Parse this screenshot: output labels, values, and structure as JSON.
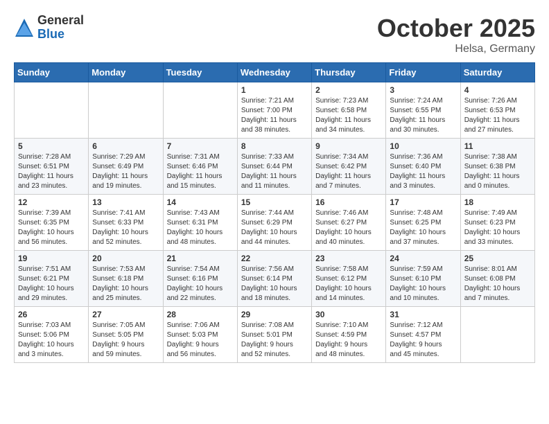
{
  "header": {
    "logo_general": "General",
    "logo_blue": "Blue",
    "month": "October 2025",
    "location": "Helsa, Germany"
  },
  "days_of_week": [
    "Sunday",
    "Monday",
    "Tuesday",
    "Wednesday",
    "Thursday",
    "Friday",
    "Saturday"
  ],
  "weeks": [
    [
      {
        "day": "",
        "info": ""
      },
      {
        "day": "",
        "info": ""
      },
      {
        "day": "",
        "info": ""
      },
      {
        "day": "1",
        "info": "Sunrise: 7:21 AM\nSunset: 7:00 PM\nDaylight: 11 hours\nand 38 minutes."
      },
      {
        "day": "2",
        "info": "Sunrise: 7:23 AM\nSunset: 6:58 PM\nDaylight: 11 hours\nand 34 minutes."
      },
      {
        "day": "3",
        "info": "Sunrise: 7:24 AM\nSunset: 6:55 PM\nDaylight: 11 hours\nand 30 minutes."
      },
      {
        "day": "4",
        "info": "Sunrise: 7:26 AM\nSunset: 6:53 PM\nDaylight: 11 hours\nand 27 minutes."
      }
    ],
    [
      {
        "day": "5",
        "info": "Sunrise: 7:28 AM\nSunset: 6:51 PM\nDaylight: 11 hours\nand 23 minutes."
      },
      {
        "day": "6",
        "info": "Sunrise: 7:29 AM\nSunset: 6:49 PM\nDaylight: 11 hours\nand 19 minutes."
      },
      {
        "day": "7",
        "info": "Sunrise: 7:31 AM\nSunset: 6:46 PM\nDaylight: 11 hours\nand 15 minutes."
      },
      {
        "day": "8",
        "info": "Sunrise: 7:33 AM\nSunset: 6:44 PM\nDaylight: 11 hours\nand 11 minutes."
      },
      {
        "day": "9",
        "info": "Sunrise: 7:34 AM\nSunset: 6:42 PM\nDaylight: 11 hours\nand 7 minutes."
      },
      {
        "day": "10",
        "info": "Sunrise: 7:36 AM\nSunset: 6:40 PM\nDaylight: 11 hours\nand 3 minutes."
      },
      {
        "day": "11",
        "info": "Sunrise: 7:38 AM\nSunset: 6:38 PM\nDaylight: 11 hours\nand 0 minutes."
      }
    ],
    [
      {
        "day": "12",
        "info": "Sunrise: 7:39 AM\nSunset: 6:35 PM\nDaylight: 10 hours\nand 56 minutes."
      },
      {
        "day": "13",
        "info": "Sunrise: 7:41 AM\nSunset: 6:33 PM\nDaylight: 10 hours\nand 52 minutes."
      },
      {
        "day": "14",
        "info": "Sunrise: 7:43 AM\nSunset: 6:31 PM\nDaylight: 10 hours\nand 48 minutes."
      },
      {
        "day": "15",
        "info": "Sunrise: 7:44 AM\nSunset: 6:29 PM\nDaylight: 10 hours\nand 44 minutes."
      },
      {
        "day": "16",
        "info": "Sunrise: 7:46 AM\nSunset: 6:27 PM\nDaylight: 10 hours\nand 40 minutes."
      },
      {
        "day": "17",
        "info": "Sunrise: 7:48 AM\nSunset: 6:25 PM\nDaylight: 10 hours\nand 37 minutes."
      },
      {
        "day": "18",
        "info": "Sunrise: 7:49 AM\nSunset: 6:23 PM\nDaylight: 10 hours\nand 33 minutes."
      }
    ],
    [
      {
        "day": "19",
        "info": "Sunrise: 7:51 AM\nSunset: 6:21 PM\nDaylight: 10 hours\nand 29 minutes."
      },
      {
        "day": "20",
        "info": "Sunrise: 7:53 AM\nSunset: 6:18 PM\nDaylight: 10 hours\nand 25 minutes."
      },
      {
        "day": "21",
        "info": "Sunrise: 7:54 AM\nSunset: 6:16 PM\nDaylight: 10 hours\nand 22 minutes."
      },
      {
        "day": "22",
        "info": "Sunrise: 7:56 AM\nSunset: 6:14 PM\nDaylight: 10 hours\nand 18 minutes."
      },
      {
        "day": "23",
        "info": "Sunrise: 7:58 AM\nSunset: 6:12 PM\nDaylight: 10 hours\nand 14 minutes."
      },
      {
        "day": "24",
        "info": "Sunrise: 7:59 AM\nSunset: 6:10 PM\nDaylight: 10 hours\nand 10 minutes."
      },
      {
        "day": "25",
        "info": "Sunrise: 8:01 AM\nSunset: 6:08 PM\nDaylight: 10 hours\nand 7 minutes."
      }
    ],
    [
      {
        "day": "26",
        "info": "Sunrise: 7:03 AM\nSunset: 5:06 PM\nDaylight: 10 hours\nand 3 minutes."
      },
      {
        "day": "27",
        "info": "Sunrise: 7:05 AM\nSunset: 5:05 PM\nDaylight: 9 hours\nand 59 minutes."
      },
      {
        "day": "28",
        "info": "Sunrise: 7:06 AM\nSunset: 5:03 PM\nDaylight: 9 hours\nand 56 minutes."
      },
      {
        "day": "29",
        "info": "Sunrise: 7:08 AM\nSunset: 5:01 PM\nDaylight: 9 hours\nand 52 minutes."
      },
      {
        "day": "30",
        "info": "Sunrise: 7:10 AM\nSunset: 4:59 PM\nDaylight: 9 hours\nand 48 minutes."
      },
      {
        "day": "31",
        "info": "Sunrise: 7:12 AM\nSunset: 4:57 PM\nDaylight: 9 hours\nand 45 minutes."
      },
      {
        "day": "",
        "info": ""
      }
    ]
  ]
}
